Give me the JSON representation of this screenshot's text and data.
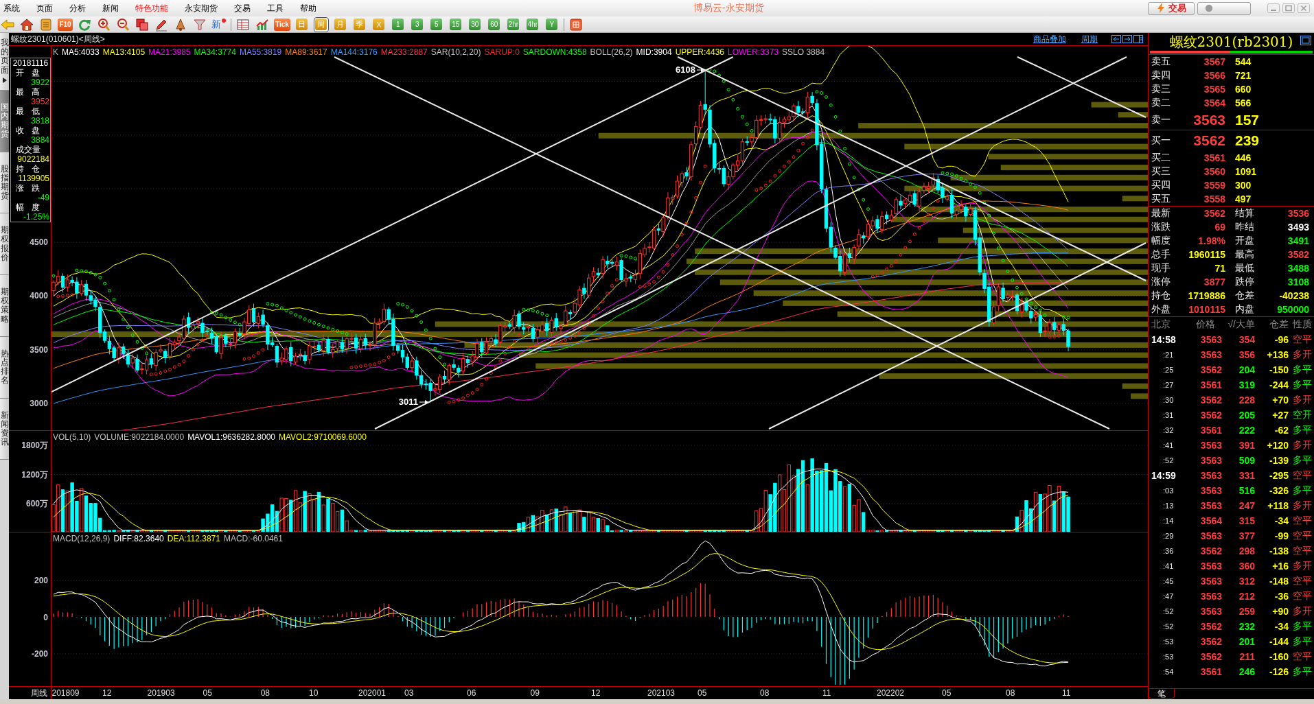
{
  "menu": [
    {
      "label": "系统",
      "highlighted": false
    },
    {
      "label": "页面",
      "highlighted": false
    },
    {
      "label": "分析",
      "highlighted": false
    },
    {
      "label": "新闻",
      "highlighted": false
    },
    {
      "label": "特色功能",
      "highlighted": true
    },
    {
      "label": "永安期货",
      "highlighted": false
    },
    {
      "label": "交易",
      "highlighted": false
    },
    {
      "label": "工具",
      "highlighted": false
    },
    {
      "label": "帮助",
      "highlighted": false
    }
  ],
  "app_title": "博易云-永安期货",
  "trade_button": "交易",
  "toolbar": {
    "f10_button": "F10",
    "new_button": "新",
    "tick_button": "Tick",
    "periods": [
      {
        "label": "日",
        "kind": "long",
        "selected": false
      },
      {
        "label": "周",
        "kind": "long",
        "selected": true
      },
      {
        "label": "月",
        "kind": "long",
        "selected": false
      },
      {
        "label": "季",
        "kind": "long",
        "selected": false
      },
      {
        "label": "X",
        "kind": "long",
        "selected": false
      },
      {
        "label": "1",
        "kind": "short",
        "selected": false
      },
      {
        "label": "3",
        "kind": "short",
        "selected": false
      },
      {
        "label": "5",
        "kind": "short",
        "selected": false
      },
      {
        "label": "15",
        "kind": "short",
        "selected": false
      },
      {
        "label": "30",
        "kind": "short",
        "selected": false
      },
      {
        "label": "60",
        "kind": "short",
        "selected": false
      },
      {
        "label": "2hr",
        "kind": "short",
        "selected": false
      },
      {
        "label": "4hr",
        "kind": "short",
        "selected": false
      },
      {
        "label": "Y",
        "kind": "short",
        "selected": false
      }
    ]
  },
  "side_tabs": [
    {
      "label": "我的页面",
      "selected": false
    },
    {
      "label": "国内期货",
      "selected": true
    },
    {
      "label": "股指期货",
      "selected": false
    },
    {
      "label": "期权报价",
      "selected": false
    },
    {
      "label": "期权策略",
      "selected": false
    },
    {
      "label": "热点排名",
      "selected": false
    },
    {
      "label": "新闻资讯",
      "selected": false
    }
  ],
  "chart_title": "螺纹2301(010601)<周线>",
  "chart_links": [
    "商品叠加",
    "周期"
  ],
  "main_chart": {
    "legend": "K",
    "indicators": [
      {
        "text": "MA5:4033",
        "color": "#ffffff"
      },
      {
        "text": "MA13:4105",
        "color": "#ffff00"
      },
      {
        "text": "MA21:3985",
        "color": "#ff00ff"
      },
      {
        "text": "MA34:3774",
        "color": "#00ff00"
      },
      {
        "text": "MA55:3819",
        "color": "#8080ff"
      },
      {
        "text": "MA89:3617",
        "color": "#ff8000"
      },
      {
        "text": "MA144:3176",
        "color": "#3399ff"
      },
      {
        "text": "MA233:2887",
        "color": "#ff3050"
      },
      {
        "text": "SAR(10,2,20)",
        "color": "#c0c0c0"
      },
      {
        "text": "SARUP:0",
        "color": "#ff2020"
      },
      {
        "text": "SARDOWN:4358",
        "color": "#00ff00"
      },
      {
        "text": "BOLL(26,2)",
        "color": "#c0c0c0"
      },
      {
        "text": "MID:3904",
        "color": "#ffffff"
      },
      {
        "text": "UPPER:4436",
        "color": "#ffff00"
      },
      {
        "text": "LOWER:3373",
        "color": "#ff00ff"
      },
      {
        "text": "SSLO 3884",
        "color": "#c0c0c0"
      }
    ],
    "y_ticks": [
      "4500",
      "4000",
      "3500",
      "3000"
    ],
    "annotations": [
      "6108",
      "3011"
    ]
  },
  "info_box": {
    "date": "20181116",
    "fields": [
      {
        "label": "开 盘",
        "value": "3922",
        "color": "#00ff00"
      },
      {
        "label": "最 高",
        "value": "3952",
        "color": "#ff3c3c"
      },
      {
        "label": "最 低",
        "value": "3818",
        "color": "#00ff00"
      },
      {
        "label": "收 盘",
        "value": "3884",
        "color": "#00ff00"
      },
      {
        "label": "成交量",
        "value": "9022184",
        "color": "#ffff00"
      },
      {
        "label": "持 仓",
        "value": "1139905",
        "color": "#ffff00"
      },
      {
        "label": "涨 跌",
        "value": "-49",
        "color": "#00ff00"
      },
      {
        "label": "幅 度",
        "value": "-1.25%",
        "color": "#00ff00"
      }
    ]
  },
  "volume_chart": {
    "indicators": [
      {
        "text": "VOL(5,10)",
        "color": "#c0c0c0"
      },
      {
        "text": "VOLUME:9022184.0000",
        "color": "#c0c0c0"
      },
      {
        "text": "MAVOL1:9636282.8000",
        "color": "#ffffff"
      },
      {
        "text": "MAVOL2:9710069.6000",
        "color": "#ffff00"
      }
    ],
    "y_ticks": [
      "1800万",
      "1200万",
      "600万"
    ]
  },
  "macd_chart": {
    "indicators": [
      {
        "text": "MACD(12,26,9)",
        "color": "#c0c0c0"
      },
      {
        "text": "DIFF:82.3640",
        "color": "#ffffff"
      },
      {
        "text": "DEA:112.3871",
        "color": "#ffff00"
      },
      {
        "text": "MACD:-60.0461",
        "color": "#c0c0c0"
      }
    ],
    "y_ticks": [
      "200",
      "0",
      "-200"
    ]
  },
  "x_axis": {
    "label": "周线",
    "ticks": [
      "201809",
      "12",
      "201903",
      "05",
      "08",
      "10",
      "202001",
      "03",
      "06",
      "09",
      "12",
      "202103",
      "05",
      "08",
      "11",
      "202202",
      "05",
      "08",
      "11"
    ]
  },
  "quote_panel": {
    "title": "螺纹2301(rb2301)",
    "ratio_bar": {
      "level": 0.49
    },
    "asks": [
      {
        "label": "卖五",
        "price": "3567",
        "volume": "544",
        "kind": "depth"
      },
      {
        "label": "卖四",
        "price": "3566",
        "volume": "721",
        "kind": "depth"
      },
      {
        "label": "卖三",
        "price": "3565",
        "volume": "660",
        "kind": "depth"
      },
      {
        "label": "卖二",
        "price": "3564",
        "volume": "566",
        "kind": "depth"
      },
      {
        "label": "卖一",
        "price": "3563",
        "volume": "157",
        "kind": "best"
      }
    ],
    "bids": [
      {
        "label": "买一",
        "price": "3562",
        "volume": "239",
        "kind": "best"
      },
      {
        "label": "买二",
        "price": "3561",
        "volume": "446",
        "kind": "depth"
      },
      {
        "label": "买三",
        "price": "3560",
        "volume": "1091",
        "kind": "depth"
      },
      {
        "label": "买四",
        "price": "3559",
        "volume": "300",
        "kind": "depth"
      },
      {
        "label": "买五",
        "price": "3558",
        "volume": "497",
        "kind": "depth"
      }
    ],
    "stats": [
      {
        "label": "最新",
        "value": "3562",
        "color": "#ff3c3c"
      },
      {
        "label": "结算",
        "value": "3536",
        "color": "#ff3c3c"
      },
      {
        "label": "涨跌",
        "value": "69",
        "color": "#ff3c3c"
      },
      {
        "label": "昨结",
        "value": "3493",
        "color": "#ffffff"
      },
      {
        "label": "幅度",
        "value": "1.98%",
        "color": "#ff3c3c"
      },
      {
        "label": "开盘",
        "value": "3491",
        "color": "#00ff00"
      },
      {
        "label": "总手",
        "value": "1960115",
        "color": "#ffff00"
      },
      {
        "label": "最高",
        "value": "3582",
        "color": "#ff3c3c"
      },
      {
        "label": "现手",
        "value": "71",
        "color": "#ffff00"
      },
      {
        "label": "最低",
        "value": "3488",
        "color": "#00ff00"
      },
      {
        "label": "涨停",
        "value": "3877",
        "color": "#ff3c3c"
      },
      {
        "label": "跌停",
        "value": "3108",
        "color": "#00ff00"
      },
      {
        "label": "持仓",
        "value": "1719886",
        "color": "#ffff00"
      },
      {
        "label": "仓差",
        "value": "-40238",
        "color": "#ffff00"
      },
      {
        "label": "外盘",
        "value": "1010115",
        "color": "#ff3c3c"
      },
      {
        "label": "内盘",
        "value": "950000",
        "color": "#00ff00"
      }
    ],
    "ticks_header": [
      "北京",
      "价格",
      "√/大单",
      "仓差",
      "性质"
    ],
    "ticks": [
      {
        "time": "14:58",
        "kind": "minute",
        "price": "3563",
        "volume": "354",
        "change": "-96",
        "nature": "空平",
        "color": "#ff3c3c"
      },
      {
        "time": ":21",
        "kind": "second",
        "price": "3563",
        "volume": "356",
        "change": "+136",
        "nature": "多开",
        "color": "#ff3c3c"
      },
      {
        "time": ":25",
        "kind": "second",
        "price": "3562",
        "volume": "204",
        "change": "-150",
        "nature": "多平",
        "color": "#00ff00"
      },
      {
        "time": ":27",
        "kind": "second",
        "price": "3561",
        "volume": "319",
        "change": "-244",
        "nature": "多平",
        "color": "#00ff00"
      },
      {
        "time": ":30",
        "kind": "second",
        "price": "3562",
        "volume": "228",
        "change": "+70",
        "nature": "多开",
        "color": "#ff3c3c"
      },
      {
        "time": ":31",
        "kind": "second",
        "price": "3562",
        "volume": "205",
        "change": "+27",
        "nature": "空开",
        "color": "#00ff00"
      },
      {
        "time": ":32",
        "kind": "second",
        "price": "3561",
        "volume": "222",
        "change": "-62",
        "nature": "多平",
        "color": "#00ff00"
      },
      {
        "time": ":41",
        "kind": "second",
        "price": "3563",
        "volume": "391",
        "change": "+120",
        "nature": "多开",
        "color": "#ff3c3c"
      },
      {
        "time": ":52",
        "kind": "second",
        "price": "3563",
        "volume": "509",
        "change": "-139",
        "nature": "多平",
        "color": "#00ff00"
      },
      {
        "time": "14:59",
        "kind": "minute",
        "price": "3563",
        "volume": "331",
        "change": "-295",
        "nature": "空平",
        "color": "#ff3c3c"
      },
      {
        "time": ":03",
        "kind": "second",
        "price": "3563",
        "volume": "516",
        "change": "-326",
        "nature": "多平",
        "color": "#00ff00"
      },
      {
        "time": ":13",
        "kind": "second",
        "price": "3563",
        "volume": "247",
        "change": "+118",
        "nature": "多开",
        "color": "#ff3c3c"
      },
      {
        "time": ":14",
        "kind": "second",
        "price": "3564",
        "volume": "315",
        "change": "-34",
        "nature": "空平",
        "color": "#ff3c3c"
      },
      {
        "time": ":29",
        "kind": "second",
        "price": "3563",
        "volume": "377",
        "change": "-99",
        "nature": "空平",
        "color": "#ff3c3c"
      },
      {
        "time": ":36",
        "kind": "second",
        "price": "3562",
        "volume": "298",
        "change": "-138",
        "nature": "空平",
        "color": "#ff3c3c"
      },
      {
        "time": ":41",
        "kind": "second",
        "price": "3563",
        "volume": "360",
        "change": "+16",
        "nature": "多开",
        "color": "#ff3c3c"
      },
      {
        "time": ":45",
        "kind": "second",
        "price": "3563",
        "volume": "312",
        "change": "-148",
        "nature": "空平",
        "color": "#ff3c3c"
      },
      {
        "time": ":47",
        "kind": "second",
        "price": "3563",
        "volume": "212",
        "change": "-36",
        "nature": "空平",
        "color": "#ff3c3c"
      },
      {
        "time": ":52",
        "kind": "second",
        "price": "3563",
        "volume": "259",
        "change": "+90",
        "nature": "多开",
        "color": "#ff3c3c"
      },
      {
        "time": ":52",
        "kind": "second",
        "price": "3562",
        "volume": "232",
        "change": "-34",
        "nature": "多平",
        "color": "#00ff00"
      },
      {
        "time": ":53",
        "kind": "second",
        "price": "3562",
        "volume": "201",
        "change": "-144",
        "nature": "多平",
        "color": "#00ff00"
      },
      {
        "time": ":53",
        "kind": "second",
        "price": "3562",
        "volume": "211",
        "change": "-160",
        "nature": "空平",
        "color": "#ff3c3c"
      },
      {
        "time": ":54",
        "kind": "second",
        "price": "3561",
        "volume": "246",
        "change": "-126",
        "nature": "多平",
        "color": "#00ff00"
      }
    ],
    "bottom_tab": "笔"
  }
}
